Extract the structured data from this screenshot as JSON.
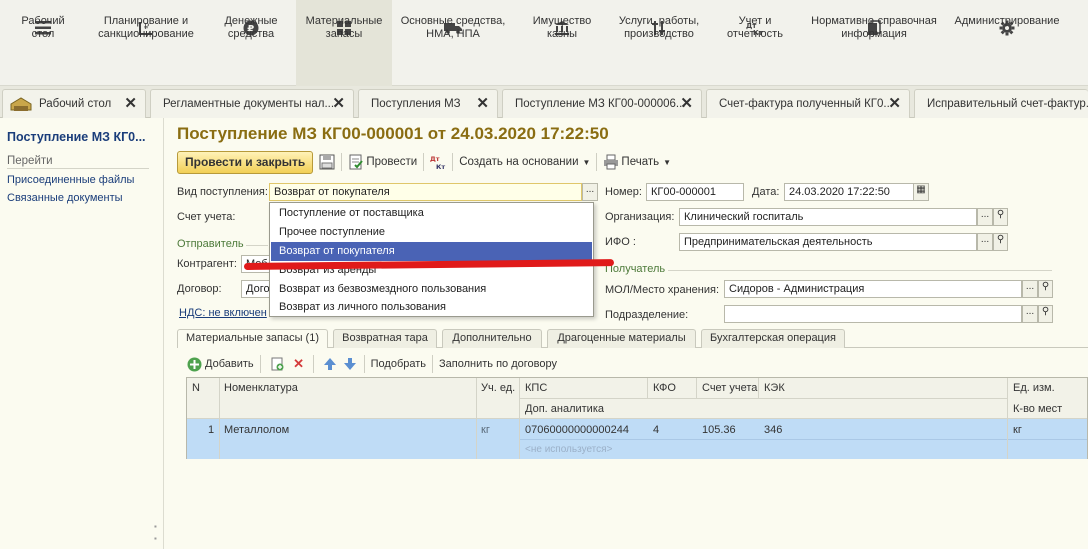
{
  "sections": [
    {
      "label": "Рабочий\nстол",
      "icon": "menu-icon"
    },
    {
      "label": "Планирование и\nсанкционирование",
      "icon": "planning-icon"
    },
    {
      "label": "Денежные\nсредства",
      "icon": "ruble-icon"
    },
    {
      "label": "Материальные\nзапасы",
      "icon": "grid-icon"
    },
    {
      "label": "Основные средства,\nНМА, НПА",
      "icon": "truck-icon"
    },
    {
      "label": "Имущество\nказны",
      "icon": "bank-icon"
    },
    {
      "label": "Услуги, работы,\nпроизводство",
      "icon": "tools-icon"
    },
    {
      "label": "Учет и\nотчетность",
      "icon": "dt-kt-icon"
    },
    {
      "label": "Нормативно-справочная\nинформация",
      "icon": "books-icon"
    },
    {
      "label": "Администрирование",
      "icon": "gear-icon"
    }
  ],
  "tabs": [
    {
      "label": "Рабочий стол"
    },
    {
      "label": "Регламентные документы нал..."
    },
    {
      "label": "Поступления МЗ"
    },
    {
      "label": "Поступление МЗ КГ00-000006..."
    },
    {
      "label": "Счет-фактура полученный КГ0..."
    },
    {
      "label": "Исправительный счет-фактур..."
    }
  ],
  "left_panel": {
    "title": "Поступление МЗ КГ0...",
    "goto": "Перейти",
    "links": [
      "Присоединенные файлы",
      "Связанные документы"
    ]
  },
  "document": {
    "title": "Поступление МЗ КГ00-000001 от 24.03.2020 17:22:50",
    "post_and_close": "Провести и закрыть",
    "post": "Провести",
    "create_based_on": "Создать на основании",
    "print": "Печать"
  },
  "form": {
    "receipt_type_label": "Вид поступления:",
    "receipt_type_value": "Возврат от покупателя",
    "account_label": "Счет учета:",
    "sender_label": "Отправитель",
    "counterparty_label": "Контрагент:",
    "counterparty_value": "Меб",
    "contract_label": "Договор:",
    "contract_value": "Дого",
    "vat_text": "НДС: не включен",
    "number_label": "Номер:",
    "number_value": "КГ00-000001",
    "date_label": "Дата:",
    "date_value": "24.03.2020 17:22:50",
    "organization_label": "Организация:",
    "organization_value": "Клинический госпиталь",
    "ifo_label": "ИФО :",
    "ifo_value": "Предпринимательская деятельность",
    "recipient_label": "Получатель",
    "mol_label": "МОЛ/Место хранения:",
    "mol_value": "Сидоров - Администрация",
    "subdivision_label": "Подразделение:",
    "subdivision_value": ""
  },
  "dropdown": {
    "options": [
      "Поступление от поставщика",
      "Прочее поступление",
      "Возврат от покупателя",
      "Возврат из аренды",
      "Возврат из безвозмездного пользования",
      "Возврат из личного пользования"
    ],
    "selected_index": 2
  },
  "inner_tabs": [
    "Материальные запасы (1)",
    "Возвратная тара",
    "Дополнительно",
    "Драгоценные материалы",
    "Бухгалтерская операция"
  ],
  "table_toolbar": {
    "add": "Добавить",
    "pick": "Подобрать",
    "fill_by_contract": "Заполнить по договору"
  },
  "grid": {
    "headers": {
      "n": "N",
      "nomenclature": "Номенклатура",
      "unit": "Уч. ед.",
      "kps": "КПС",
      "kfo": "КФО",
      "account": "Счет учета",
      "kek": "КЭК",
      "uom": "Ед. изм.",
      "extra_analytics": "Доп. аналитика",
      "places_count": "К-во мест"
    },
    "rows": [
      {
        "n": "1",
        "nomenclature": "Металлолом",
        "unit": "кг",
        "kps": "07060000000000244",
        "kfo": "4",
        "account": "105.36",
        "kek": "346",
        "uom": "кг",
        "extra_analytics": "<не используется>"
      }
    ]
  }
}
